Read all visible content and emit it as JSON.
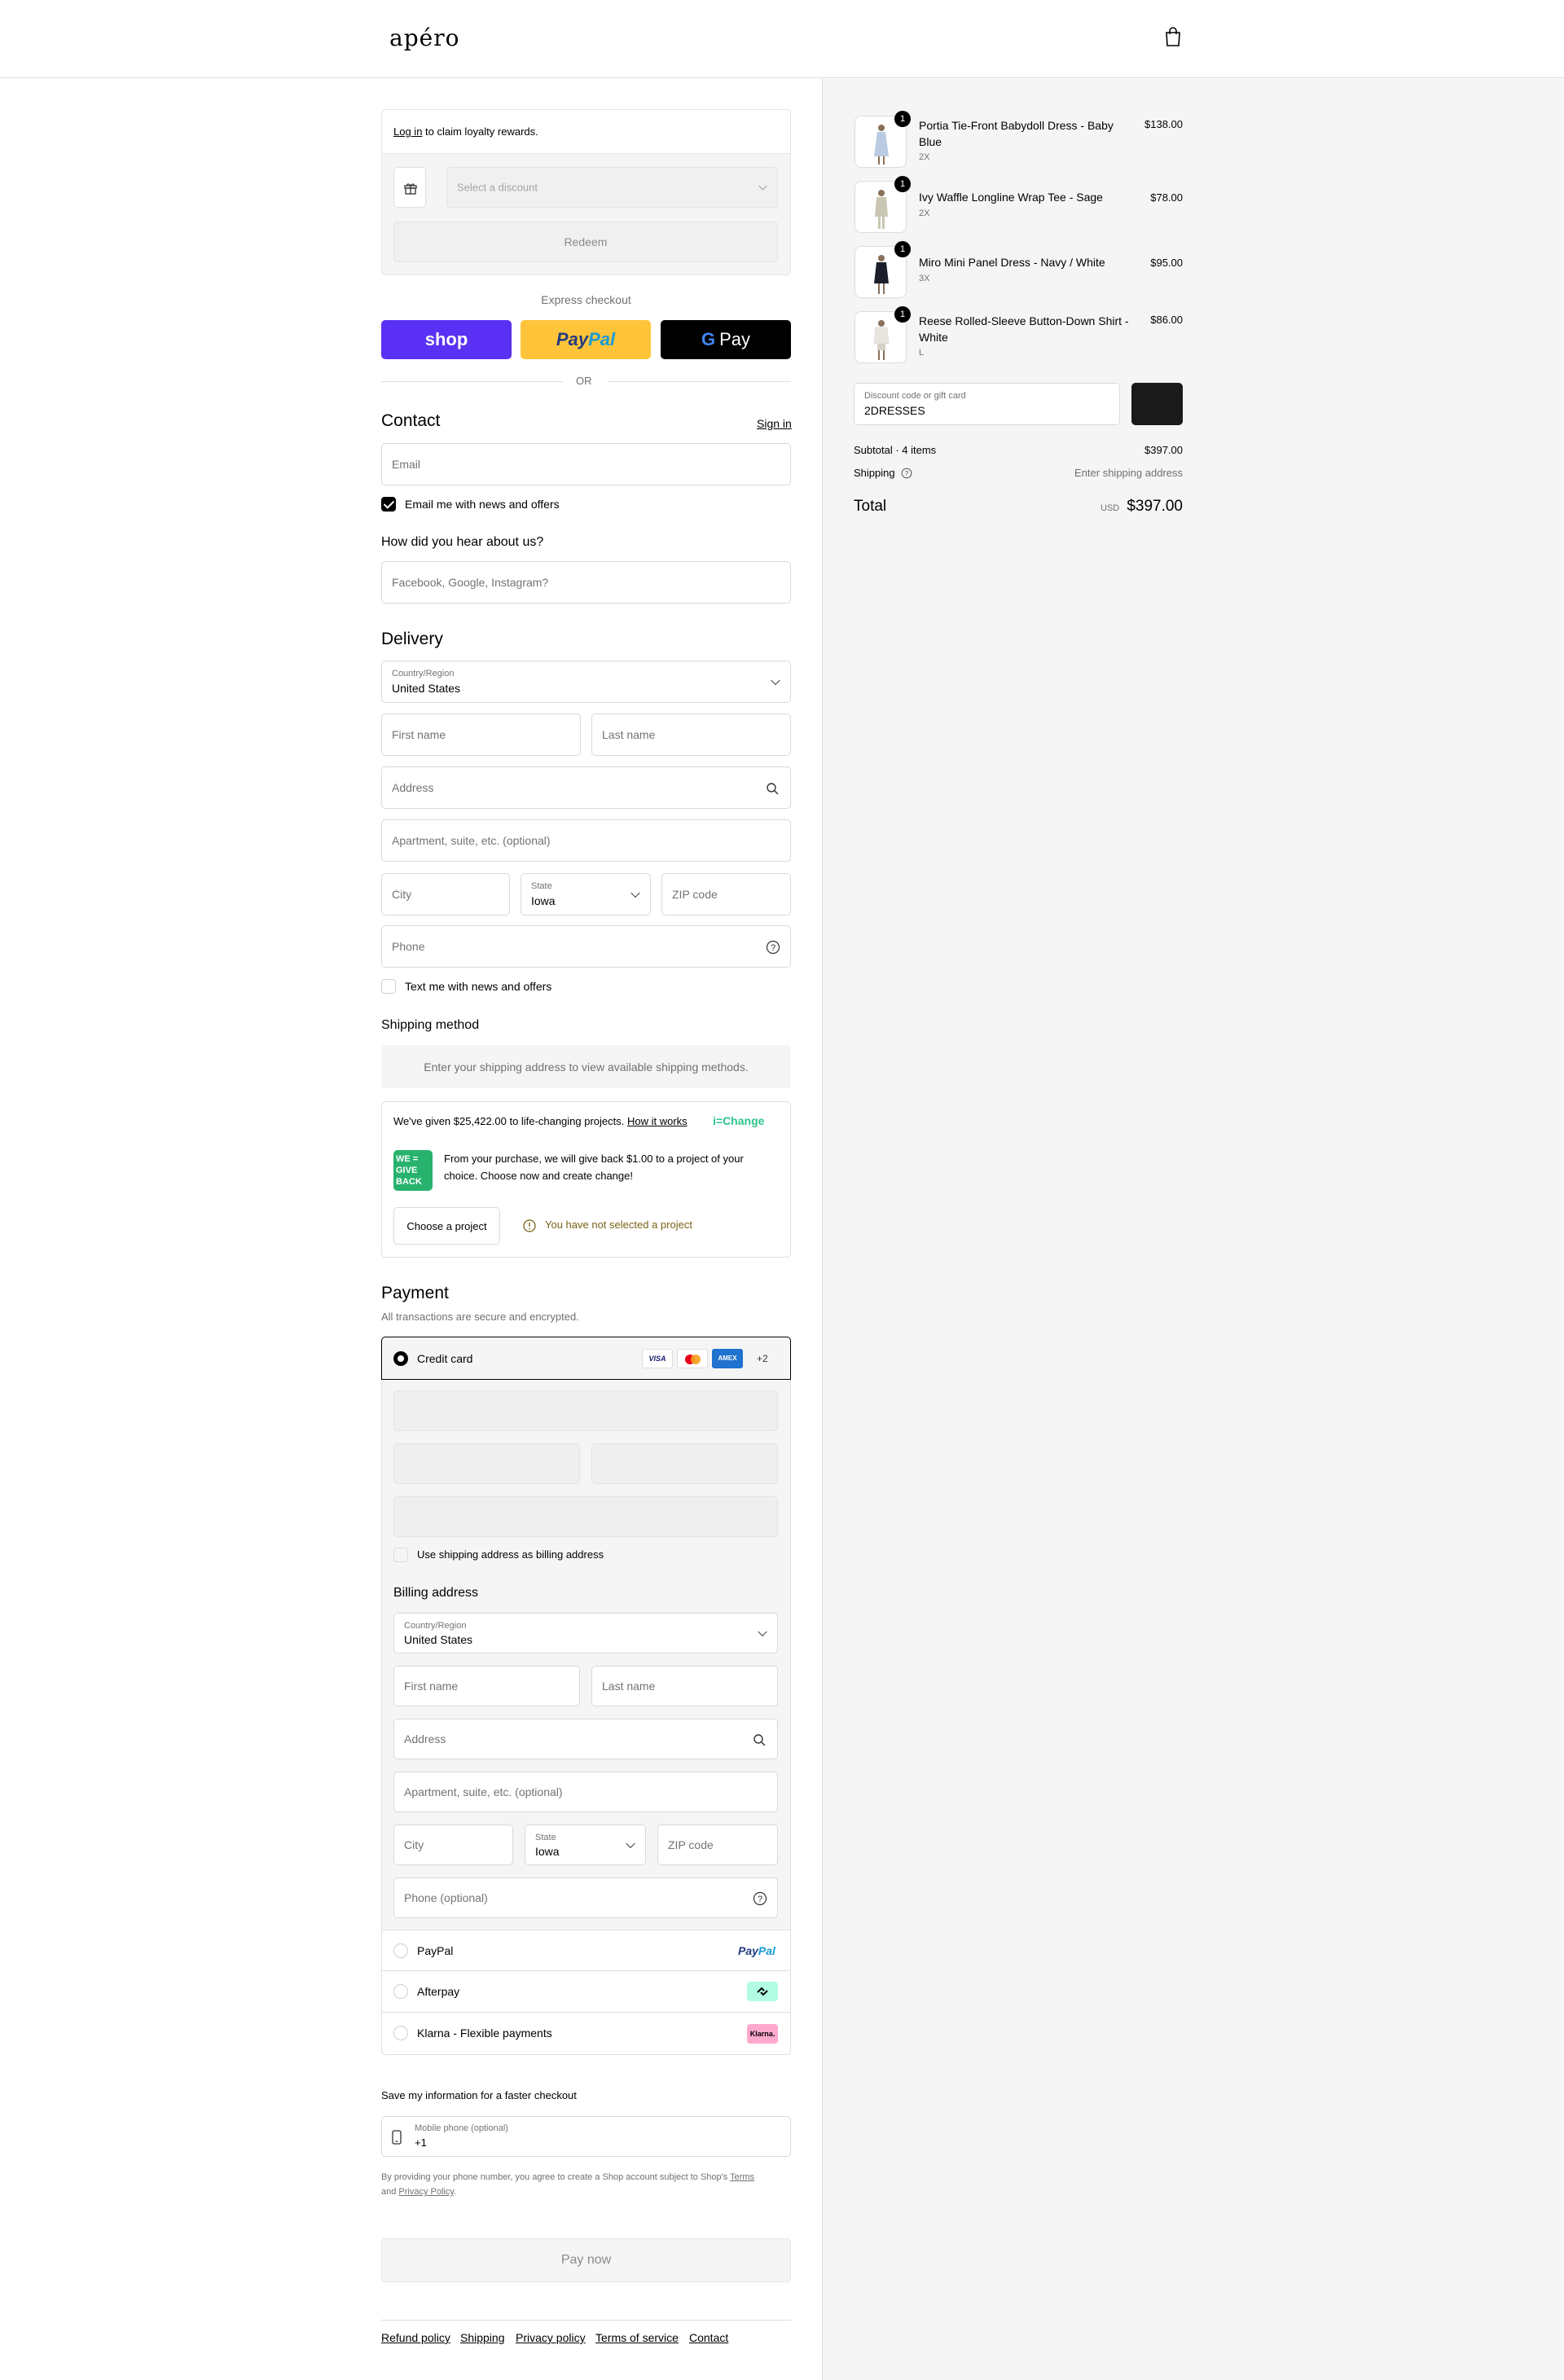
{
  "header": {
    "logo": "apéro",
    "bag_icon": "shopping-bag-icon"
  },
  "loyalty": {
    "login_link": "Log in",
    "rest": " to claim loyalty rewards.",
    "discount_select_placeholder": "Select a discount",
    "redeem_label": "Redeem"
  },
  "express": {
    "title": "Express checkout",
    "shop_label": "shop",
    "paypal_label_1": "Pay",
    "paypal_label_2": "Pal",
    "gpay_label": "Pay",
    "or_label": "OR"
  },
  "contact": {
    "title": "Contact",
    "sign_in": "Sign in",
    "email_placeholder": "Email",
    "news_label": "Email me with news and offers",
    "news_checked": true
  },
  "survey": {
    "title": "How did you hear about us?",
    "placeholder": "Facebook, Google, Instagram?"
  },
  "delivery": {
    "title": "Delivery",
    "country_label": "Country/Region",
    "country_value": "United States",
    "first_name": "First name",
    "last_name": "Last name",
    "address": "Address",
    "apartment": "Apartment, suite, etc. (optional)",
    "city": "City",
    "state_label": "State",
    "state_value": "Iowa",
    "zip": "ZIP code",
    "phone": "Phone",
    "text_label": "Text me with news and offers"
  },
  "shipping": {
    "title": "Shipping method",
    "message": "Enter your shipping address to view available shipping methods."
  },
  "change": {
    "given_text": "We've given $25,422.00 to life-changing projects.",
    "how_it_works": "How it works",
    "brand": "i=Change",
    "badge_line1": "WE =",
    "badge_line2": "GIVE",
    "badge_line3": "BACK",
    "body_line1": "From your purchase, we will give back $1.00 to a project of your",
    "body_line2": "choice. Choose now and create change!",
    "choose_label": "Choose a project",
    "warning": "You have not selected a project",
    "warning_color": "#7a6415"
  },
  "payment": {
    "title": "Payment",
    "subtitle": "All transactions are secure and encrypted.",
    "credit_card": "Credit card",
    "card_brands": [
      "VISA",
      "mastercard",
      "AMEX"
    ],
    "more_brands": "+2",
    "billing_checkbox": "Use shipping address as billing address",
    "billing_title": "Billing address",
    "billing": {
      "country_label": "Country/Region",
      "country_value": "United States",
      "first_name": "First name",
      "last_name": "Last name",
      "address": "Address",
      "apartment": "Apartment, suite, etc. (optional)",
      "city": "City",
      "state_label": "State",
      "state_value": "Iowa",
      "zip": "ZIP code",
      "phone": "Phone (optional)"
    },
    "paypal": "PayPal",
    "paypal_logo_1": "Pay",
    "paypal_logo_2": "Pal",
    "afterpay": "Afterpay",
    "klarna": "Klarna - Flexible payments",
    "klarna_logo": "Klarna."
  },
  "save_info": {
    "title": "Save my information for a faster checkout",
    "phone_label": "Mobile phone (optional)",
    "phone_value": "+1",
    "disclaimer_1": "By providing your phone number, you agree to create a Shop account subject to Shop's ",
    "terms": "Terms",
    "disclaimer_2": "and ",
    "privacy": "Privacy Policy",
    "disclaimer_3": "."
  },
  "pay_now": "Pay now",
  "footer": {
    "links": [
      "Refund policy",
      "Shipping",
      "Privacy policy",
      "Terms of service",
      "Contact"
    ]
  },
  "cart": {
    "items": [
      {
        "name_line1": "Portia Tie-Front Babydoll Dress - Baby",
        "name_line2": "Blue",
        "variant": "2X",
        "price": "$138.00",
        "qty": "1",
        "color": "#b8cbe0"
      },
      {
        "name_line1": "Ivy Waffle Longline Wrap Tee - Sage",
        "name_line2": "",
        "variant": "2X",
        "price": "$78.00",
        "qty": "1",
        "color": "#c9c7b3"
      },
      {
        "name_line1": "Miro Mini Panel Dress - Navy / White",
        "name_line2": "",
        "variant": "3X",
        "price": "$95.00",
        "qty": "1",
        "color": "#1c1f2b"
      },
      {
        "name_line1": "Reese Rolled-Sleeve Button-Down Shirt -",
        "name_line2": "White",
        "variant": "L",
        "price": "$86.00",
        "qty": "1",
        "color": "#e8e5df"
      }
    ],
    "discount_label": "Discount code or gift card",
    "discount_value": "2DRESSES",
    "subtotal_label": "Subtotal · 4 items",
    "subtotal_value": "$397.00",
    "shipping_label": "Shipping",
    "shipping_value": "Enter shipping address",
    "total_label": "Total",
    "currency": "USD",
    "total_value": "$397.00"
  }
}
